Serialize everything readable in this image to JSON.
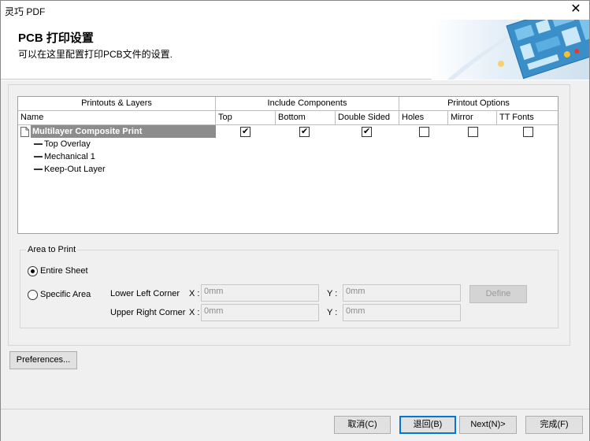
{
  "window": {
    "title": "灵巧 PDF",
    "close_glyph": "✕"
  },
  "header": {
    "title": "PCB 打印设置",
    "subtitle": "可以在这里配置打印PCB文件的设置."
  },
  "layers_table": {
    "group_headers": [
      "Printouts & Layers",
      "Include Components",
      "Printout Options"
    ],
    "columns": [
      "Name",
      "Top",
      "Bottom",
      "Double Sided",
      "Holes",
      "Mirror",
      "TT Fonts"
    ],
    "printout": {
      "name": "Multilayer Composite Print",
      "top": true,
      "bottom": true,
      "double_sided": true,
      "holes": false,
      "mirror": false,
      "tt_fonts": false
    },
    "layers": [
      "Top Overlay",
      "Mechanical 1",
      "Keep-Out Layer"
    ]
  },
  "area_to_print": {
    "legend": "Area to Print",
    "options": [
      {
        "label": "Entire Sheet",
        "selected": true
      },
      {
        "label": "Specific Area",
        "selected": false
      }
    ],
    "lower_left_label": "Lower Left Corner",
    "upper_right_label": "Upper Right Corner",
    "x_label": "X :",
    "y_label": "Y :",
    "lower_left_x": "0mm",
    "lower_left_y": "0mm",
    "upper_right_x": "0mm",
    "upper_right_y": "0mm",
    "define_label": "Define"
  },
  "preferences_label": "Preferences...",
  "footer": {
    "cancel": "取消(C)",
    "back": "退回(B)",
    "next": "Next(N)>",
    "finish": "完成(F)"
  }
}
